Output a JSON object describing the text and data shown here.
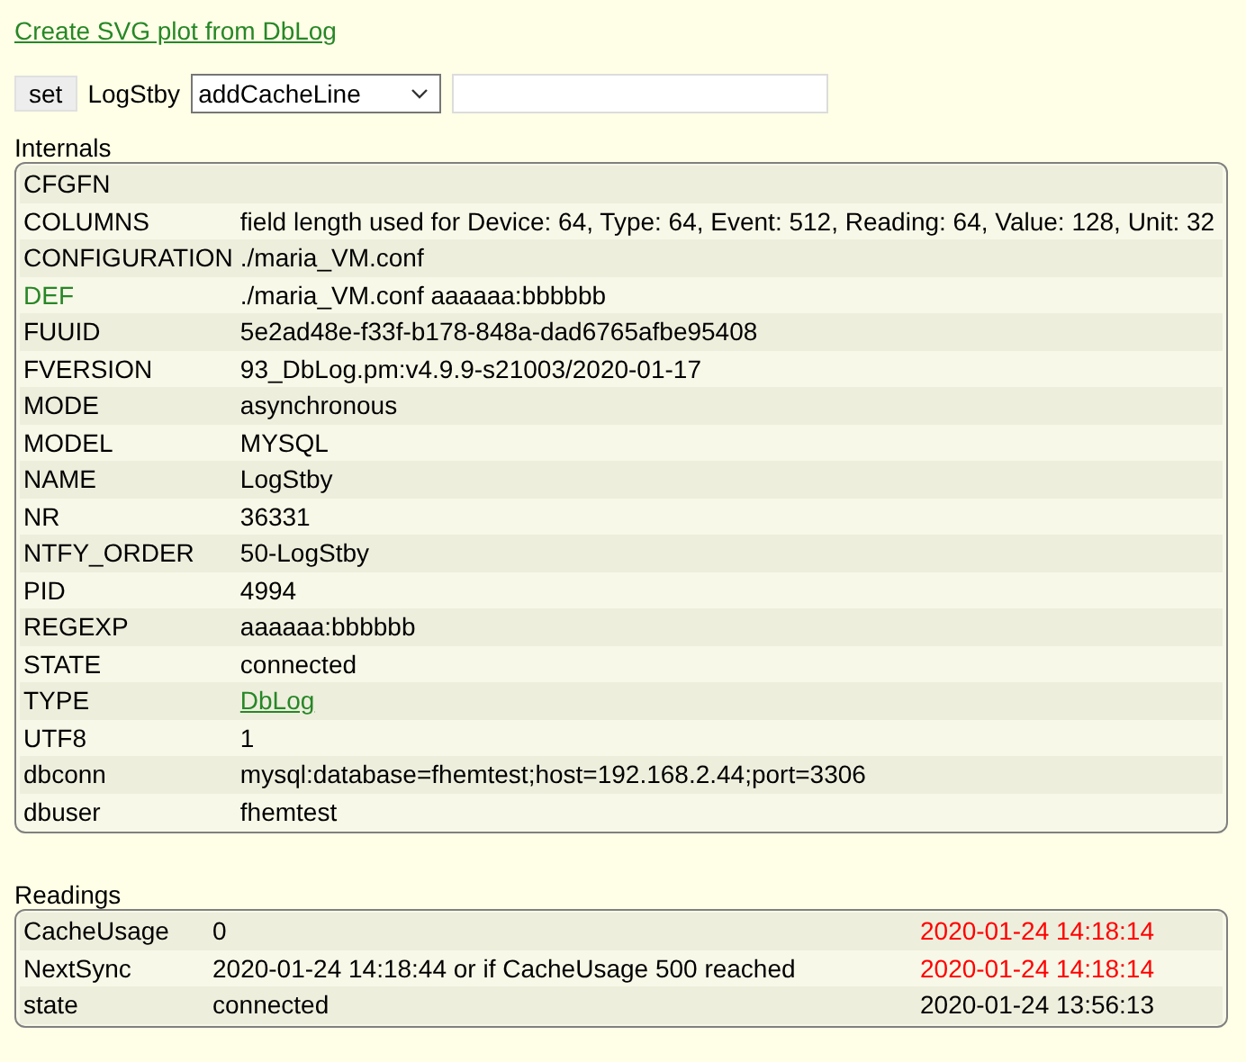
{
  "plot_link": "Create SVG plot from DbLog",
  "set_bar": {
    "button": "set",
    "device": "LogStby",
    "command": "addCacheLine"
  },
  "internals": {
    "title": "Internals",
    "rows": [
      {
        "name": {
          "text": "CFGFN",
          "kind": "text"
        }
      },
      {
        "name": {
          "text": "COLUMNS",
          "kind": "text"
        },
        "value": {
          "text": "field length used for Device: 64, Type: 64, Event: 512, Reading: 64, Value: 128, Unit: 32",
          "kind": "text"
        }
      },
      {
        "name": {
          "text": "CONFIGURATION",
          "kind": "text"
        },
        "value": {
          "text": "./maria_VM.conf",
          "kind": "text"
        }
      },
      {
        "name": {
          "text": "DEF",
          "kind": "link"
        },
        "value": {
          "text": "./maria_VM.conf aaaaaa:bbbbbb",
          "kind": "text"
        }
      },
      {
        "name": {
          "text": "FUUID",
          "kind": "text"
        },
        "value": {
          "text": "5e2ad48e-f33f-b178-848a-dad6765afbe95408",
          "kind": "text"
        }
      },
      {
        "name": {
          "text": "FVERSION",
          "kind": "text"
        },
        "value": {
          "text": "93_DbLog.pm:v4.9.9-s21003/2020-01-17",
          "kind": "text"
        }
      },
      {
        "name": {
          "text": "MODE",
          "kind": "text"
        },
        "value": {
          "text": "asynchronous",
          "kind": "text"
        }
      },
      {
        "name": {
          "text": "MODEL",
          "kind": "text"
        },
        "value": {
          "text": "MYSQL",
          "kind": "text"
        }
      },
      {
        "name": {
          "text": "NAME",
          "kind": "text"
        },
        "value": {
          "text": "LogStby",
          "kind": "text"
        }
      },
      {
        "name": {
          "text": "NR",
          "kind": "text"
        },
        "value": {
          "text": "36331",
          "kind": "text"
        }
      },
      {
        "name": {
          "text": "NTFY_ORDER",
          "kind": "text"
        },
        "value": {
          "text": "50-LogStby",
          "kind": "text"
        }
      },
      {
        "name": {
          "text": "PID",
          "kind": "text"
        },
        "value": {
          "text": "4994",
          "kind": "text"
        }
      },
      {
        "name": {
          "text": "REGEXP",
          "kind": "text"
        },
        "value": {
          "text": "aaaaaa:bbbbbb",
          "kind": "text"
        }
      },
      {
        "name": {
          "text": "STATE",
          "kind": "text"
        },
        "value": {
          "text": "connected",
          "kind": "text"
        }
      },
      {
        "name": {
          "text": "TYPE",
          "kind": "text"
        },
        "value": {
          "text": "DbLog",
          "kind": "link"
        }
      },
      {
        "name": {
          "text": "UTF8",
          "kind": "text"
        },
        "value": {
          "text": "1",
          "kind": "text"
        }
      },
      {
        "name": {
          "text": "dbconn",
          "kind": "text"
        },
        "value": {
          "text": "mysql:database=fhemtest;host=192.168.2.44;port=3306",
          "kind": "text"
        }
      },
      {
        "name": {
          "text": "dbuser",
          "kind": "text"
        },
        "value": {
          "text": "fhemtest",
          "kind": "text"
        }
      }
    ]
  },
  "readings": {
    "title": "Readings",
    "rows": [
      {
        "name": "CacheUsage",
        "value": "0",
        "time": "2020-01-24 14:18:14",
        "recent": true
      },
      {
        "name": "NextSync",
        "value": "2020-01-24 14:18:44 or if CacheUsage 500 reached",
        "time": "2020-01-24 14:18:14",
        "recent": true
      },
      {
        "name": "state",
        "value": "connected",
        "time": "2020-01-24 13:56:13",
        "recent": false
      }
    ]
  }
}
